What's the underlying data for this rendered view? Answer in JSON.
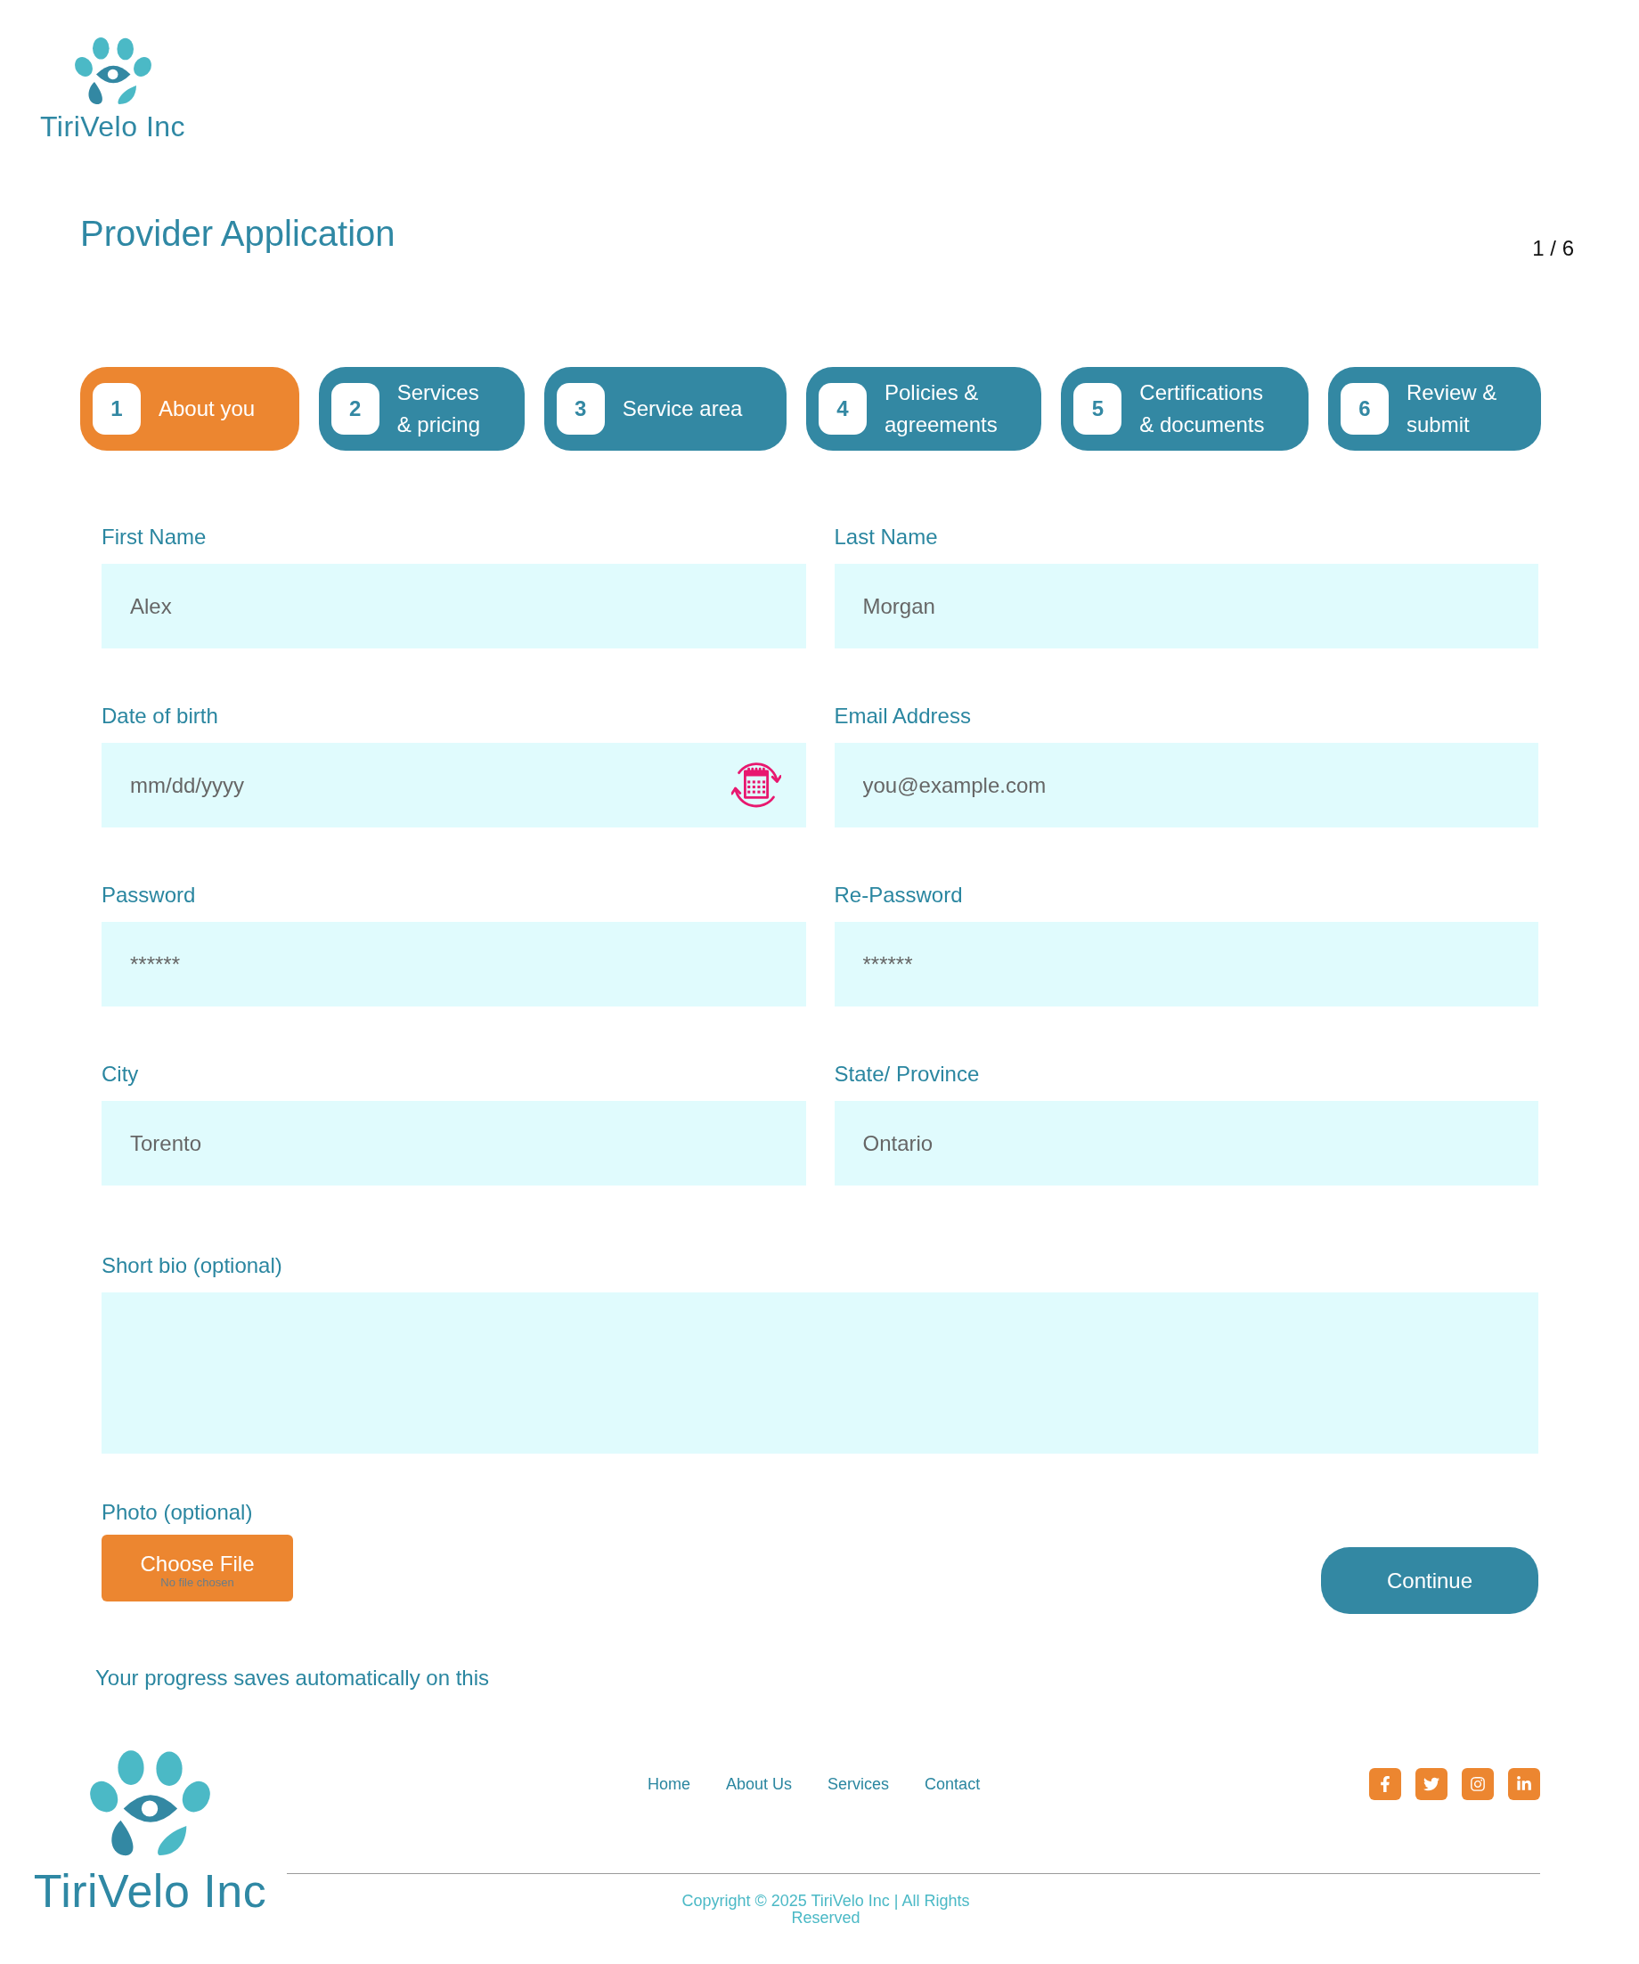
{
  "header": {
    "logo_text": "TiriVelo Inc"
  },
  "page": {
    "title": "Provider Application",
    "step_counter": "1 / 6"
  },
  "steps": [
    {
      "number": "1",
      "label": "About you",
      "selected": true
    },
    {
      "number": "2",
      "label": "Services\n& pricing",
      "selected": false
    },
    {
      "number": "3",
      "label": "Service area",
      "selected": false
    },
    {
      "number": "4",
      "label": "Policies &\nagreements",
      "selected": false
    },
    {
      "number": "5",
      "label": "Certifications\n& documents",
      "selected": false
    },
    {
      "number": "6",
      "label": "Review &\nsubmit",
      "selected": false
    }
  ],
  "fields": [
    {
      "kind": "text",
      "label": "First Name",
      "value": "Alex"
    },
    {
      "kind": "text",
      "label": "Last Name",
      "value": "Morgan"
    },
    {
      "kind": "date",
      "label": "Date of birth",
      "placeholder": "mm/dd/yyyy"
    },
    {
      "kind": "text",
      "label": "Email Address",
      "placeholder": "you@example.com"
    },
    {
      "kind": "text",
      "label": "Password",
      "value": "******"
    },
    {
      "kind": "text",
      "label": "Re-Password",
      "value": "******"
    },
    {
      "kind": "text",
      "label": "City",
      "value": "Torento"
    },
    {
      "kind": "text",
      "label": "State/ Province",
      "value": "Ontario"
    }
  ],
  "bio": {
    "label": "Short bio (optional)"
  },
  "photo": {
    "label": "Photo (optional)",
    "button": "Choose File",
    "status": "No file chosen"
  },
  "continue_button": "Continue",
  "autosave_note": "Your progress saves automatically on this",
  "footer": {
    "logo_text": "TiriVelo Inc",
    "nav_links": [
      "Home",
      "About Us",
      "Services",
      "Contact"
    ],
    "copyright": "Copyright © 2025 TiriVelo Inc | All Rights Reserved"
  }
}
